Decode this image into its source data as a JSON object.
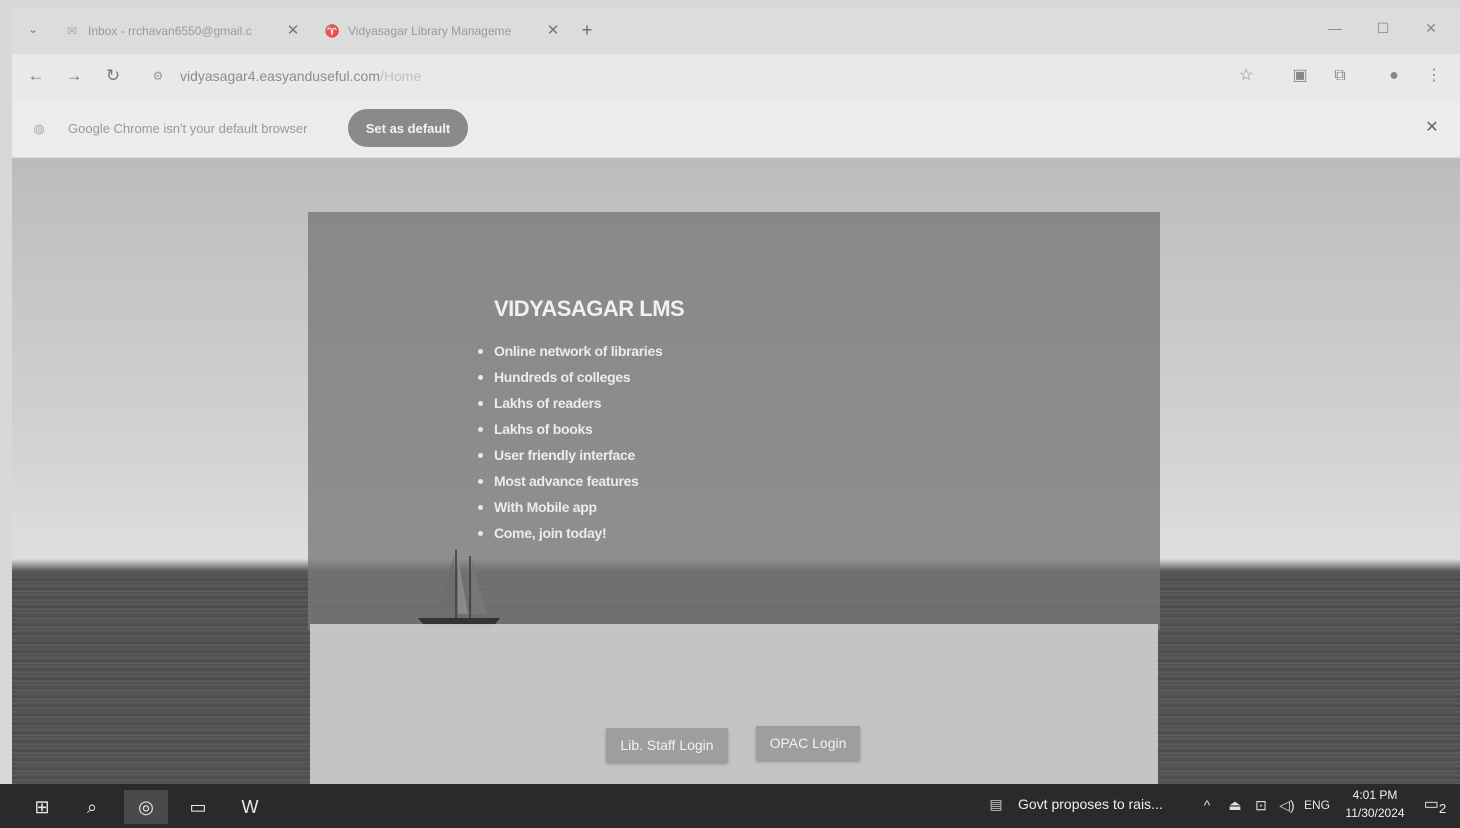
{
  "browser": {
    "tabs": [
      {
        "label": "Inbox - rrchavan6550@gmail.c",
        "icon": "gmail-icon"
      },
      {
        "label": "Vidyasagar Library Manageme",
        "icon": "vidyasagar-favicon"
      }
    ],
    "url_domain": "vidyasagar4.easyanduseful.com",
    "url_path": "/Home",
    "infobar_text": "Google Chrome isn't your default browser",
    "set_default_label": "Set as default"
  },
  "page": {
    "title": "VIDYASAGAR LMS",
    "features": [
      "Online network of libraries",
      "Hundreds of colleges",
      "Lakhs of readers",
      "Lakhs of books",
      "User friendly interface",
      "Most advance features",
      "With Mobile app",
      "Come, join today!"
    ],
    "staff_login_label": "Lib. Staff Login",
    "opac_login_label": "OPAC Login"
  },
  "taskbar": {
    "news_text": "Govt proposes to rais...",
    "language": "ENG",
    "time": "4:01 PM",
    "date": "11/30/2024",
    "notification_count": "2"
  }
}
